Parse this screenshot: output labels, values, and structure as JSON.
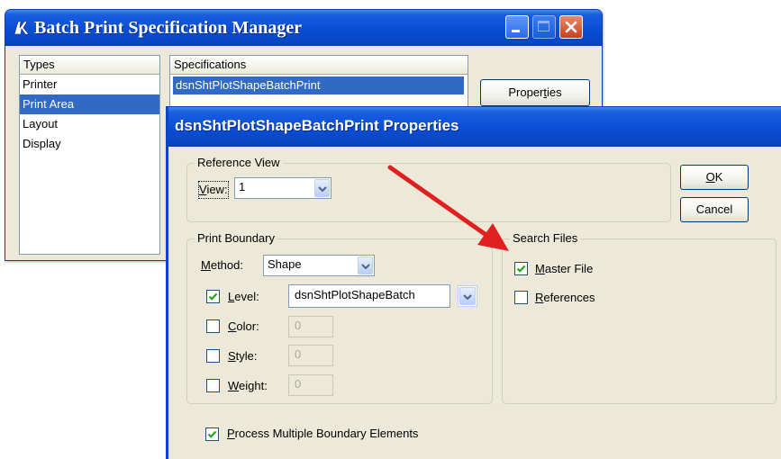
{
  "back_window": {
    "title": "Batch Print Specification Manager",
    "types_header": "Types",
    "types": [
      "Printer",
      "Print Area",
      "Layout",
      "Display"
    ],
    "selected_type": "Print Area",
    "specs_header": "Specifications",
    "specs": [
      "dsnShtPlotShapeBatchPrint"
    ],
    "properties_button": {
      "pre": "Proper",
      "key": "t",
      "post": "ies"
    }
  },
  "dialog": {
    "title": "dsnShtPlotShapeBatchPrint Properties",
    "reference_view": {
      "legend": "Reference View",
      "view_label_key": "V",
      "view_label_rest": "iew:",
      "view_value": "1"
    },
    "print_boundary": {
      "legend": "Print Boundary",
      "method_key": "M",
      "method_rest": "ethod:",
      "method_value": "Shape",
      "level": {
        "key": "L",
        "rest": "evel:",
        "checked": true,
        "value": "dsnShtPlotShapeBatch"
      },
      "color": {
        "key": "C",
        "rest": "olor:",
        "checked": false,
        "value": "0"
      },
      "style": {
        "key": "S",
        "rest": "tyle:",
        "checked": false,
        "value": "0"
      },
      "weight": {
        "key": "W",
        "rest": "eight:",
        "checked": false,
        "value": "0"
      }
    },
    "search_files": {
      "legend": "Search Files",
      "master": {
        "key": "M",
        "rest": "aster File",
        "checked": true
      },
      "references": {
        "key": "R",
        "rest": "eferences",
        "checked": false
      }
    },
    "process_multiple": {
      "key": "P",
      "rest": "rocess Multiple Boundary Elements",
      "checked": true
    },
    "ok_button": {
      "key": "O",
      "rest": "K"
    },
    "cancel_button": "Cancel"
  },
  "colors": {
    "titlebar_blue": "#0a4fd6",
    "selection_blue": "#316ac5",
    "dialog_face": "#ece9d8",
    "annotation_arrow": "#e02020"
  },
  "icons": [
    "app-icon",
    "minimize-icon",
    "maximize-icon",
    "close-icon",
    "chevron-down-icon",
    "checkmark-icon",
    "annotation-arrow"
  ]
}
